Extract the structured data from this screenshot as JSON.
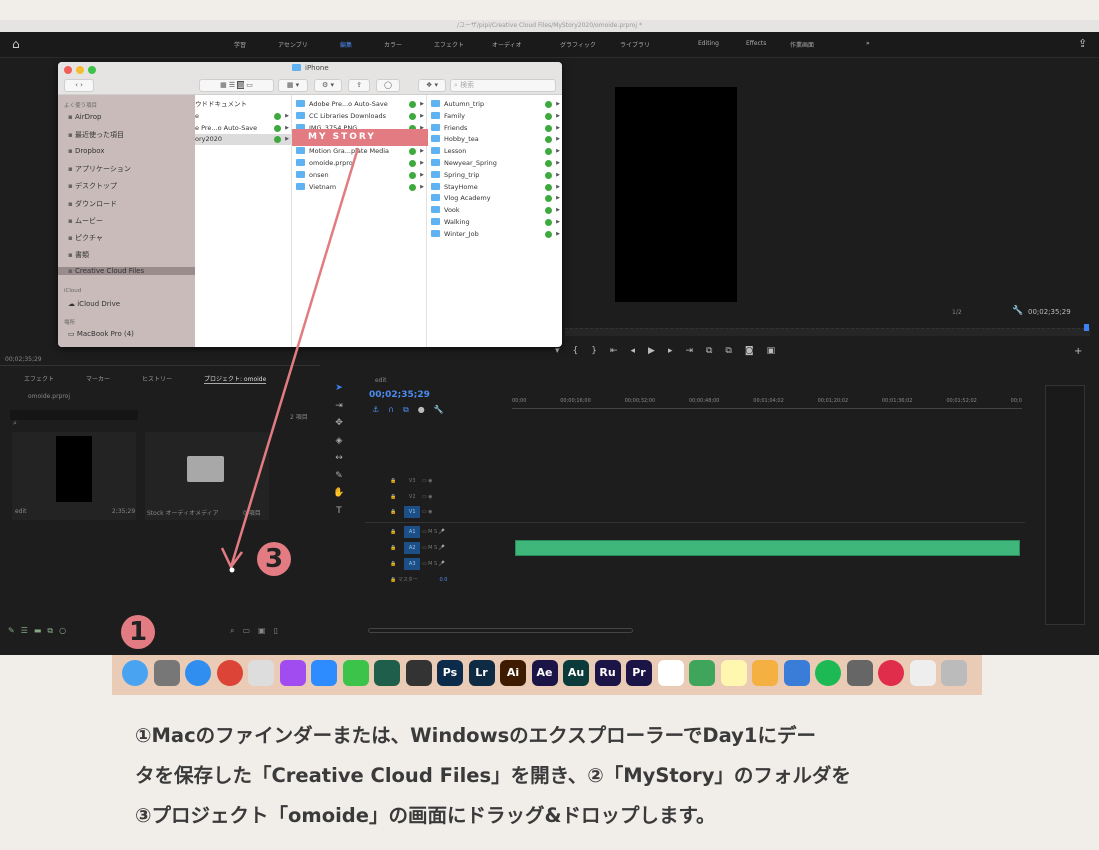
{
  "window": {
    "title": "/ユーザ/pipi/Creative Cloud Files/MyStory2020/omoide.prproj *"
  },
  "workspace": {
    "tabs": [
      "学習",
      "アセンブリ",
      "編集",
      "カラー",
      "エフェクト",
      "オーディオ",
      "グラフィック",
      "ライブラリ",
      "Editing",
      "Effects",
      "作業画面"
    ],
    "active": "編集",
    "more": "»"
  },
  "finder": {
    "title": "iPhone",
    "search_placeholder": "検索",
    "sidebar": {
      "favorites_header": "よく使う項目",
      "items": [
        "AirDrop",
        "最近使った項目",
        "Dropbox",
        "アプリケーション",
        "デスクトップ",
        "ダウンロード",
        "ムービー",
        "ピクチャ",
        "書類",
        "Creative Cloud Files"
      ],
      "selected": "Creative Cloud Files",
      "icloud_header": "iCloud",
      "icloud_items": [
        "iCloud Drive"
      ],
      "places_header": "場所",
      "places_items": [
        "MacBook Pro (4)"
      ]
    },
    "col1": [
      "ウドドキュメント",
      "e",
      "e Pre...o Auto-Save",
      "ory2020"
    ],
    "col2": [
      "Adobe Pre...o Auto-Save",
      "CC Libraries Downloads",
      "IMG_3754.PNG",
      "MyStory",
      "Motion Gra...plate Media",
      "omoide.prproj",
      "onsen",
      "Vietnam"
    ],
    "col3": [
      "Autumn_trip",
      "Family",
      "Friends",
      "Hobby_tea",
      "Lesson",
      "Newyear_Spring",
      "Spring_trip",
      "StayHome",
      "Vlog Academy",
      "Vook",
      "Walking",
      "Winter_Job"
    ]
  },
  "annotation": {
    "drag_label": "MY STORY",
    "step1": "1",
    "step3": "3",
    "color": "#e27c82"
  },
  "program": {
    "zoom": "1/2",
    "timecode": "00;02;35;29"
  },
  "source": {
    "timecode": "00;02;35;29"
  },
  "project_panel": {
    "tabs": [
      "エフェクト",
      "マーカー",
      "ヒストリー",
      "プロジェクト: omoide"
    ],
    "file": "omoide.prproj",
    "item_count": "2 項目",
    "items": [
      {
        "name": "edit",
        "duration": "2;35;29"
      },
      {
        "name": "Stock オーディオメディア",
        "duration": "0 項目"
      }
    ]
  },
  "timeline": {
    "sequence": "edit",
    "timecode": "00;02;35;29",
    "ruler": [
      "00;00",
      "00;00;16;00",
      "00;00;32;00",
      "00;00;48;00",
      "00;01;04;02",
      "00;01;20;02",
      "00;01;36;02",
      "00;01;52;02",
      "00;0"
    ],
    "video_tracks": [
      "V3",
      "V2",
      "V1"
    ],
    "audio_tracks": [
      "A1",
      "A2",
      "A3"
    ],
    "master": "マスター",
    "master_value": "0.0"
  },
  "dock": {
    "icons": [
      {
        "name": "finder",
        "label": "",
        "color": "#4aa3f0"
      },
      {
        "name": "launchpad",
        "label": "",
        "color": "#777"
      },
      {
        "name": "safari",
        "label": "",
        "color": "#2f8ef0"
      },
      {
        "name": "chrome",
        "label": "",
        "color": "#db4437"
      },
      {
        "name": "screenshot",
        "label": "",
        "color": "#ddd"
      },
      {
        "name": "messenger",
        "label": "",
        "color": "#a04cf0"
      },
      {
        "name": "zoom",
        "label": "",
        "color": "#2d8cff"
      },
      {
        "name": "line",
        "label": "",
        "color": "#3cc34a"
      },
      {
        "name": "filmora",
        "label": "",
        "color": "#1f5e4a"
      },
      {
        "name": "davinci",
        "label": "",
        "color": "#333"
      },
      {
        "name": "photoshop",
        "label": "Ps",
        "color": "#0c2b4a"
      },
      {
        "name": "lightroom",
        "label": "Lr",
        "color": "#0f2b44"
      },
      {
        "name": "illustrator",
        "label": "Ai",
        "color": "#3d1a00"
      },
      {
        "name": "after-effects",
        "label": "Ae",
        "color": "#1b1547"
      },
      {
        "name": "audition",
        "label": "Au",
        "color": "#0b3a3a"
      },
      {
        "name": "rush",
        "label": "Ru",
        "color": "#1b1547"
      },
      {
        "name": "premiere",
        "label": "Pr",
        "color": "#1b1547"
      },
      {
        "name": "slack",
        "label": "",
        "color": "#fff"
      },
      {
        "name": "maps",
        "label": "",
        "color": "#3fa55a"
      },
      {
        "name": "notes",
        "label": "",
        "color": "#fff6b0"
      },
      {
        "name": "photos",
        "label": "",
        "color": "#f4b040"
      },
      {
        "name": "keynote",
        "label": "",
        "color": "#3a7dd8"
      },
      {
        "name": "spotify",
        "label": "",
        "color": "#1db954"
      },
      {
        "name": "preferences",
        "label": "",
        "color": "#666"
      },
      {
        "name": "creative-cloud",
        "label": "",
        "color": "#e02d4c"
      },
      {
        "name": "preview",
        "label": "",
        "color": "#eee"
      },
      {
        "name": "trash",
        "label": "",
        "color": "#bbb"
      }
    ]
  },
  "caption": {
    "lines": [
      "①Macのファインダーまたは、WindowsのエクスプローラーでDay1にデー",
      "タを保存した「Creative Cloud Files」を開き、②「MyStory」のフォルダを",
      "③プロジェクト「omoide」の画面にドラッグ&ドロップします。"
    ]
  }
}
